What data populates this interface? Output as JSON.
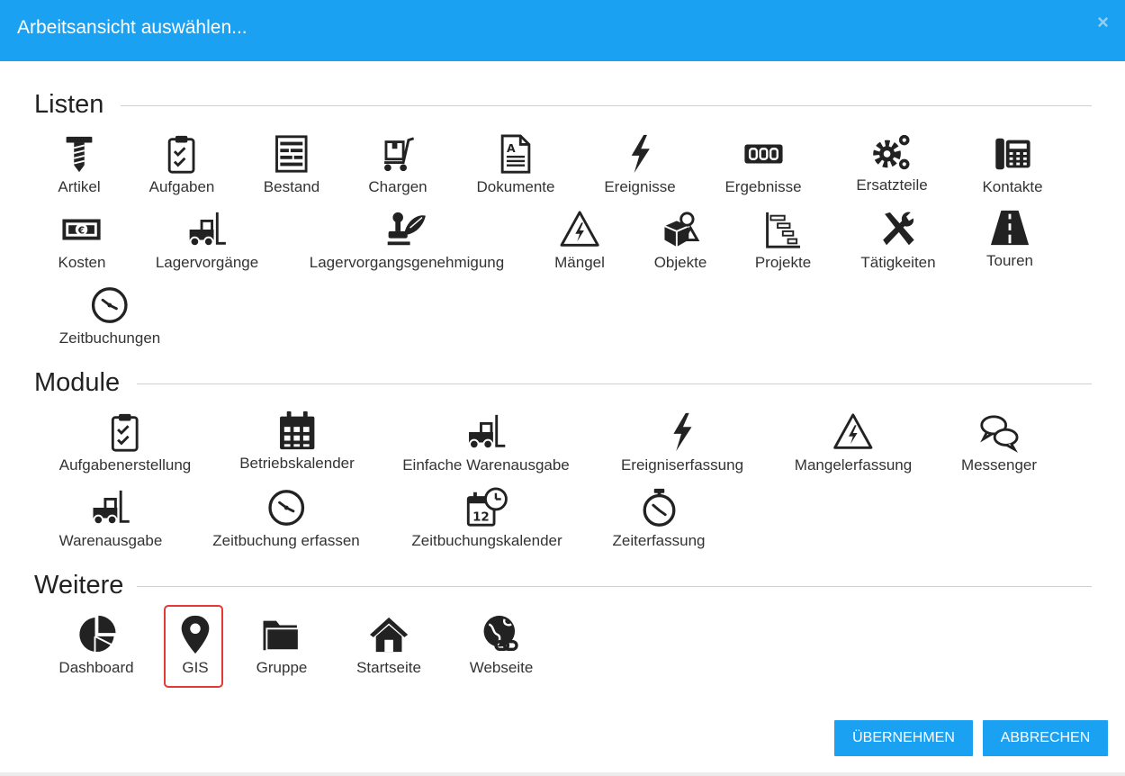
{
  "dialog": {
    "title": "Arbeitsansicht auswählen...",
    "close_label": "×"
  },
  "sections": {
    "listen": "Listen",
    "module": "Module",
    "weitere": "Weitere"
  },
  "listen": [
    {
      "label": "Artikel",
      "icon": "screw-icon"
    },
    {
      "label": "Aufgaben",
      "icon": "clipboard-check-icon"
    },
    {
      "label": "Bestand",
      "icon": "shelf-icon"
    },
    {
      "label": "Chargen",
      "icon": "hand-truck-icon"
    },
    {
      "label": "Dokumente",
      "icon": "document-icon"
    },
    {
      "label": "Ereignisse",
      "icon": "lightning-icon"
    },
    {
      "label": "Ergebnisse",
      "icon": "counter-icon"
    },
    {
      "label": "Ersatzteile",
      "icon": "gears-icon"
    },
    {
      "label": "Kontakte",
      "icon": "phone-icon"
    },
    {
      "label": "Kosten",
      "icon": "money-icon"
    },
    {
      "label": "Lagervorgänge",
      "icon": "forklift-icon"
    },
    {
      "label": "Lagervorgangsgenehmigung",
      "icon": "stamp-icon"
    },
    {
      "label": "Mängel",
      "icon": "warning-icon"
    },
    {
      "label": "Objekte",
      "icon": "objects-icon"
    },
    {
      "label": "Projekte",
      "icon": "gantt-icon"
    },
    {
      "label": "Tätigkeiten",
      "icon": "tools-icon"
    },
    {
      "label": "Touren",
      "icon": "road-icon"
    },
    {
      "label": "Zeitbuchungen",
      "icon": "clock-icon"
    }
  ],
  "module": [
    {
      "label": "Aufgabenerstellung",
      "icon": "clipboard-check-icon"
    },
    {
      "label": "Betriebskalender",
      "icon": "calendar-icon"
    },
    {
      "label": "Einfache Warenausgabe",
      "icon": "forklift-icon"
    },
    {
      "label": "Ereigniserfassung",
      "icon": "lightning-icon"
    },
    {
      "label": "Mangelerfassung",
      "icon": "warning-icon"
    },
    {
      "label": "Messenger",
      "icon": "chat-icon"
    },
    {
      "label": "Warenausgabe",
      "icon": "forklift-icon"
    },
    {
      "label": "Zeitbuchung erfassen",
      "icon": "clock-icon"
    },
    {
      "label": "Zeitbuchungskalender",
      "icon": "calendar-clock-icon"
    },
    {
      "label": "Zeiterfassung",
      "icon": "stopwatch-icon"
    }
  ],
  "weitere": [
    {
      "label": "Dashboard",
      "icon": "pie-chart-icon"
    },
    {
      "label": "GIS",
      "icon": "map-pin-icon",
      "selected": true
    },
    {
      "label": "Gruppe",
      "icon": "folder-icon"
    },
    {
      "label": "Startseite",
      "icon": "home-icon"
    },
    {
      "label": "Webseite",
      "icon": "globe-link-icon"
    }
  ],
  "buttons": {
    "apply": "ÜBERNEHMEN",
    "cancel": "ABBRECHEN"
  },
  "colors": {
    "accent": "#1ba1f1",
    "selection_border": "#e53935",
    "icon": "#222222"
  }
}
